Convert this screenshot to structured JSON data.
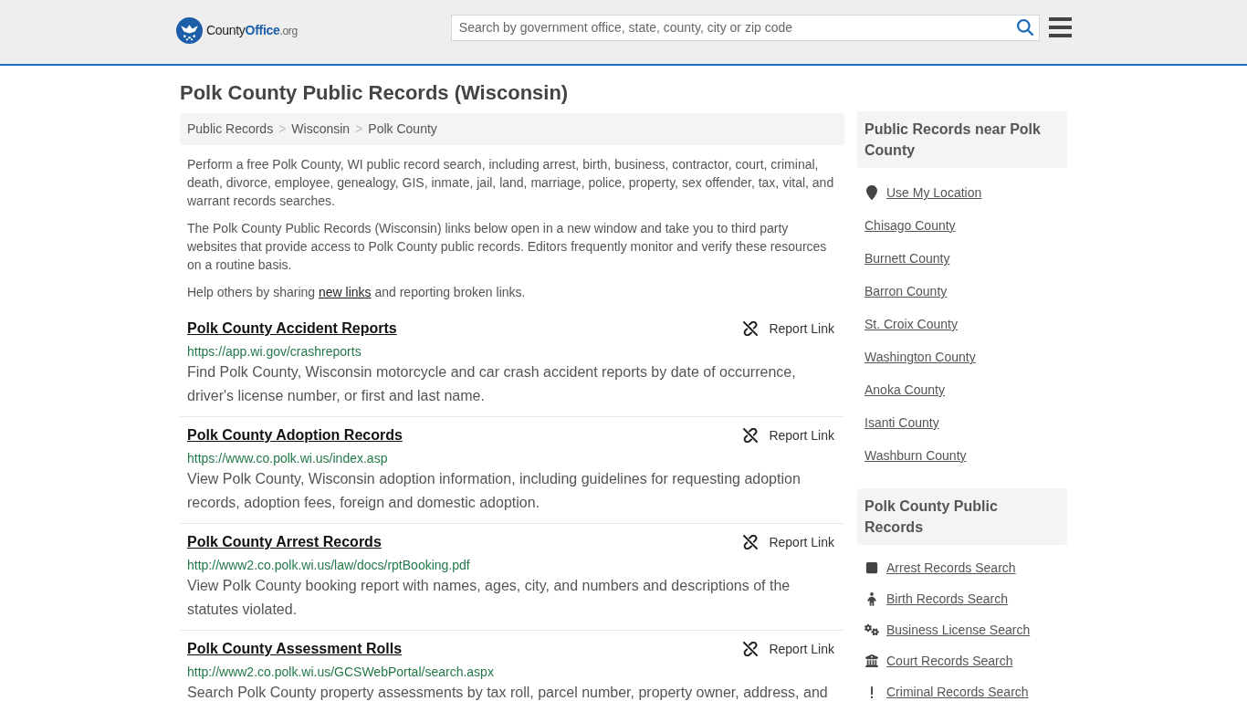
{
  "header": {
    "logo": {
      "parts": [
        {
          "kind": "name",
          "text": "County"
        },
        {
          "kind": "brand",
          "text": "Office"
        },
        {
          "kind": "domain",
          "text": ".org"
        }
      ]
    },
    "search": {
      "placeholder": "Search by government office, state, county, city or zip code"
    }
  },
  "page": {
    "title": "Polk County Public Records (Wisconsin)"
  },
  "breadcrumbs": [
    {
      "kind": "link",
      "text": "Public Records"
    },
    {
      "kind": "separator",
      "text": ">"
    },
    {
      "kind": "link",
      "text": "Wisconsin"
    },
    {
      "kind": "separator",
      "text": ">"
    },
    {
      "kind": "link",
      "text": "Polk County"
    }
  ],
  "intro": [
    {
      "parts": [
        {
          "kind": "text",
          "text": "Perform a free Polk County, WI public record search, including arrest, birth, business, contractor, court, criminal, death, divorce, employee, genealogy, GIS, inmate, jail, land, marriage, police, property, sex offender, tax, vital, and warrant records searches."
        }
      ]
    },
    {
      "parts": [
        {
          "kind": "text",
          "text": "The Polk County Public Records (Wisconsin) links below open in a new window and take you to third party websites that provide access to Polk County public records. Editors frequently monitor and verify these resources on a routine basis."
        }
      ]
    },
    {
      "parts": [
        {
          "kind": "text",
          "text": "Help others by sharing "
        },
        {
          "kind": "link",
          "text": "new links"
        },
        {
          "kind": "text",
          "text": " and reporting broken links."
        }
      ]
    }
  ],
  "listings": [
    {
      "title": "Polk County Accident Reports",
      "report": "Report Link",
      "url": "https://app.wi.gov/crashreports",
      "description": "Find Polk County, Wisconsin motorcycle and car crash accident reports by date of occurrence, driver's license number, or first and last name."
    },
    {
      "title": "Polk County Adoption Records",
      "report": "Report Link",
      "url": "https://www.co.polk.wi.us/index.asp",
      "description": "View Polk County, Wisconsin adoption information, including guidelines for requesting adoption records, adoption fees, foreign and domestic adoption."
    },
    {
      "title": "Polk County Arrest Records",
      "report": "Report Link",
      "url": "http://www2.co.polk.wi.us/law/docs/rptBooking.pdf",
      "description": "View Polk County booking report with names, ages, city, and numbers and descriptions of the statutes violated."
    },
    {
      "title": "Polk County Assessment Rolls",
      "report": "Report Link",
      "url": "http://www2.co.polk.wi.us/GCSWebPortal/search.aspx",
      "description": "Search Polk County property assessments by tax roll, parcel number, property owner, address, and"
    }
  ],
  "sidebar": [
    {
      "heading": "Public Records near Polk County",
      "items": [
        {
          "kind": "location",
          "label": "Use My Location"
        },
        {
          "kind": "plain",
          "label": "Chisago County"
        },
        {
          "kind": "plain",
          "label": "Burnett County"
        },
        {
          "kind": "plain",
          "label": "Barron County"
        },
        {
          "kind": "plain",
          "label": "St. Croix County"
        },
        {
          "kind": "plain",
          "label": "Washington County"
        },
        {
          "kind": "plain",
          "label": "Anoka County"
        },
        {
          "kind": "plain",
          "label": "Isanti County"
        },
        {
          "kind": "plain",
          "label": "Washburn County"
        }
      ]
    },
    {
      "heading": "Polk County Public Records",
      "items": [
        {
          "kind": "arrest",
          "label": "Arrest Records Search"
        },
        {
          "kind": "birth",
          "label": "Birth Records Search"
        },
        {
          "kind": "business",
          "label": "Business License Search"
        },
        {
          "kind": "court",
          "label": "Court Records Search"
        },
        {
          "kind": "criminal",
          "label": "Criminal Records Search"
        }
      ]
    }
  ]
}
